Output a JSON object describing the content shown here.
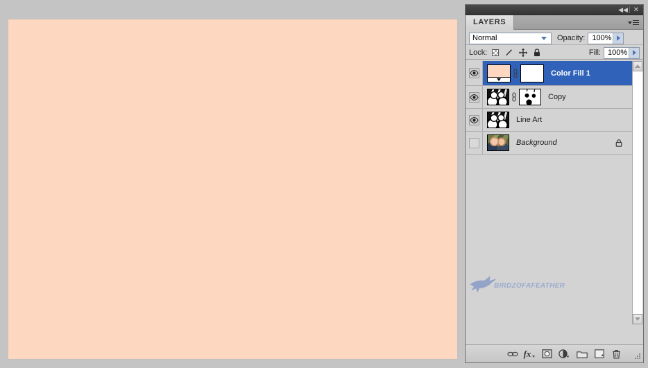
{
  "window": {
    "titlebar": {
      "collapse_label": "◀◀",
      "close_label": "✕"
    }
  },
  "panel": {
    "tab_label": "LAYERS",
    "menu_icon": "panel-menu-icon"
  },
  "blend_row": {
    "blend_mode": "Normal",
    "opacity_label": "Opacity:",
    "opacity_value": "100%"
  },
  "lock_row": {
    "lock_label": "Lock:",
    "lock_icons": [
      "lock-transparent-pixels-icon",
      "lock-image-pixels-icon",
      "lock-position-icon",
      "lock-all-icon"
    ],
    "fill_label": "Fill:",
    "fill_value": "100%"
  },
  "layers": [
    {
      "name": "Color Fill 1",
      "visible": true,
      "selected": true,
      "linked": true,
      "locked": false,
      "thumb_type": "solid-fill-swatch",
      "mask_type": "white-mask"
    },
    {
      "name": "Copy",
      "visible": true,
      "selected": false,
      "linked": true,
      "locked": false,
      "thumb_type": "line-art-photo",
      "mask_type": "black-white-mask"
    },
    {
      "name": "Line Art",
      "visible": true,
      "selected": false,
      "linked": false,
      "locked": false,
      "thumb_type": "line-art-photo",
      "mask_type": null
    },
    {
      "name": "Background",
      "visible": false,
      "selected": false,
      "linked": false,
      "locked": true,
      "italic": true,
      "thumb_type": "color-photo",
      "mask_type": null
    }
  ],
  "watermark": {
    "glyph": "bird-logo-icon",
    "text": "BIRDZOFAFEATHER"
  },
  "scrollbar": {
    "up_icon": "scroll-up-arrow-icon",
    "down_icon": "scroll-down-arrow-icon"
  },
  "footer_buttons": [
    {
      "name": "link-layers-button",
      "icon": "chain-link-icon",
      "glyph": "⛓"
    },
    {
      "name": "add-layer-style-button",
      "icon": "fx-icon",
      "glyph": "fx"
    },
    {
      "name": "add-layer-mask-button",
      "icon": "layer-mask-icon",
      "glyph": ""
    },
    {
      "name": "new-adjustment-layer-button",
      "icon": "half-circle-icon",
      "glyph": ""
    },
    {
      "name": "new-group-button",
      "icon": "folder-icon",
      "glyph": ""
    },
    {
      "name": "new-layer-button",
      "icon": "new-layer-icon",
      "glyph": ""
    },
    {
      "name": "delete-layer-button",
      "icon": "trash-icon",
      "glyph": ""
    }
  ],
  "canvas": {
    "fill_color": "#fdd7c0"
  },
  "colors": {
    "selection_blue": "#2f62b8",
    "panel_gray": "#d3d3d3",
    "desktop_gray": "#c4c4c4",
    "titlebar_dark": "#3f3f3f",
    "canvas_peach": "#fdd7c0",
    "watermark_blue": "#93a6cf"
  }
}
